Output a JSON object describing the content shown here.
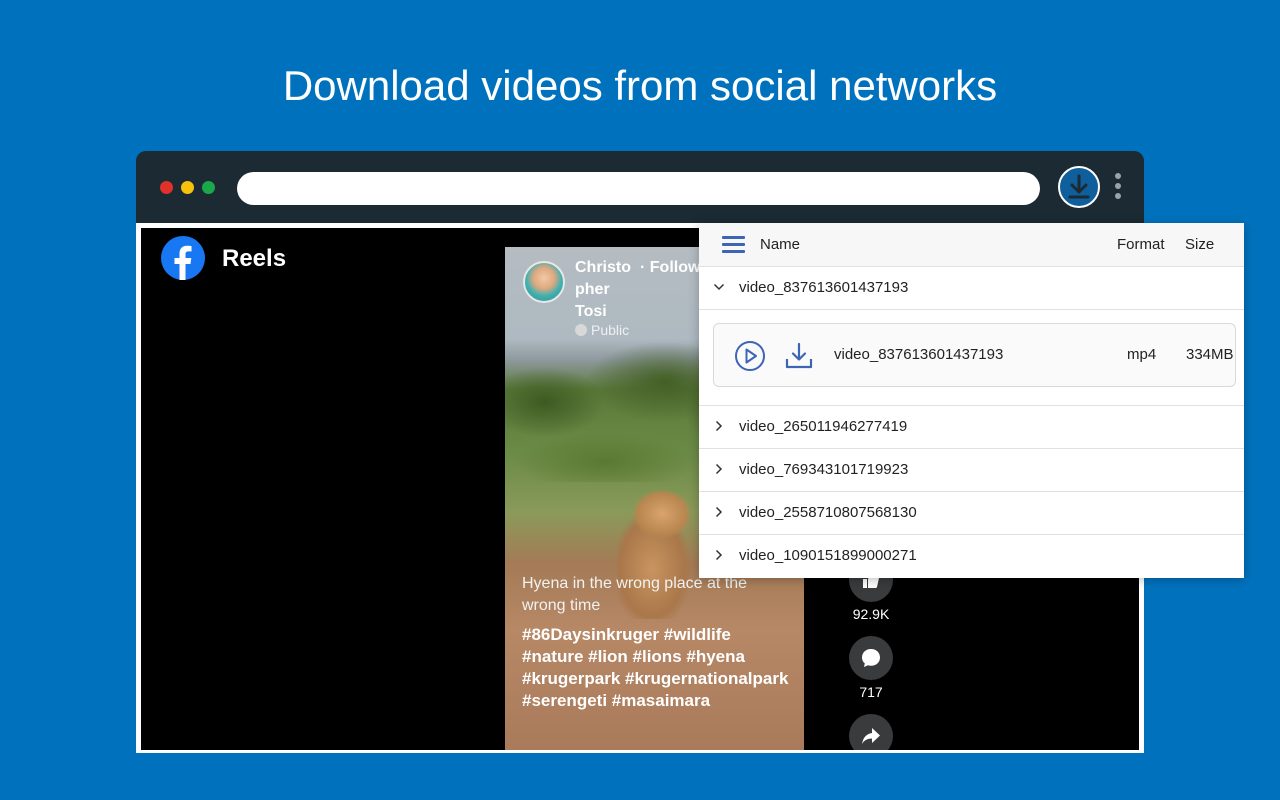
{
  "headline": "Download videos from social networks",
  "colors": {
    "background": "#0072bd",
    "browser_chrome": "#1b2a33",
    "accent": "#3e64b6",
    "facebook_blue": "#1877f2"
  },
  "page": {
    "title": "Reels",
    "reel": {
      "author": "Christo pher Tosi",
      "follow_label": "· Follow",
      "audience": "Public",
      "caption": "Hyena in the wrong place at the wrong time",
      "hashtags": "#86Daysinkruger #wildlife #nature #lion #lions #hyena #krugerpark #krugernationalpark #serengeti #masaimara"
    },
    "actions": {
      "likes": "92.9K",
      "comments": "717"
    }
  },
  "panel": {
    "columns": {
      "name": "Name",
      "format": "Format",
      "size": "Size"
    },
    "expanded_group": {
      "label": "video_837613601437193",
      "file": {
        "name": "video_837613601437193",
        "format": "mp4",
        "size": "334MB"
      }
    },
    "collapsed_groups": [
      "video_265011946277419",
      "video_769343101719923",
      "video_2558710807568130",
      "video_1090151899000271"
    ]
  },
  "icons": {
    "extension": "download-icon",
    "menu": "hamburger-menu-icon",
    "play": "play-circle-icon",
    "download": "download-tray-icon",
    "like": "like-icon",
    "comment": "comment-icon",
    "share": "share-icon"
  }
}
